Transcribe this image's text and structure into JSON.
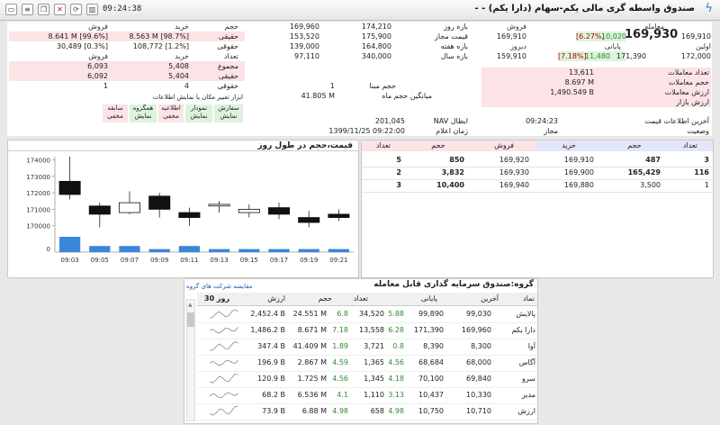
{
  "titlebar": {
    "time": "09:24:38",
    "title": "صندوق واسطه گری مالی یکم-سهام (دارا یکم) - -",
    "icons": [
      "window-icon",
      "doc-icon",
      "copy-icon",
      "chart-icon",
      "sync-icon",
      "bars-icon"
    ]
  },
  "depth_summary": {
    "headers": {
      "buy": "خرید",
      "volume": "حجم",
      "sell": "فروش"
    },
    "rows": [
      {
        "buy": "8.563 M [98.7%]",
        "label": "حقیقی",
        "sell": "8.641 M [99.6%]"
      },
      {
        "buy": "108,772 [1.2%]",
        "label": "حقوقی",
        "sell": "30,489 [0.3%]"
      }
    ],
    "count_header_buy": "خرید",
    "count_header_sell": "فروش",
    "count_rows": [
      {
        "buy": "5,408",
        "label": "حقیقی",
        "sell": "6,093"
      },
      {
        "buy": "5,404",
        "label": "حقیقی",
        "sell": "6,092"
      },
      {
        "buy": "4",
        "label": "حقوقی",
        "sell": "1"
      }
    ],
    "count_label": "تعداد",
    "total_label": "مجموع"
  },
  "range": {
    "rows": [
      {
        "label": "بازه روز",
        "a": "174,210",
        "b": "169,960"
      },
      {
        "label": "قیمت مجاز",
        "a": "175,900",
        "b": "153,520"
      },
      {
        "label": "بازه هفته",
        "a": "164,800",
        "b": "139,000"
      },
      {
        "label": "بازه سال",
        "a": "340,000",
        "b": "97,110"
      }
    ]
  },
  "price": {
    "label_trade": "معامله",
    "label_last": "فروش",
    "trade": "169,930",
    "change": "10,020",
    "change_pct": "[6.27%]",
    "close": "169,910",
    "label_close": "اولین",
    "open_label": "دیروز",
    "yesterday": "159,910",
    "last_label": "پایانی",
    "last": "171,390",
    "last_change": "11,480",
    "last_pct": "[7.18%]",
    "first": "172,000"
  },
  "stats": {
    "rows": [
      {
        "label": "تعداد معاملات",
        "value": "13,611"
      },
      {
        "label": "حجم معاملات",
        "value": "8.697 M"
      },
      {
        "label": "ارزش معاملات",
        "value": "1,490.549 B"
      },
      {
        "label": "ارزش بازار",
        "value": ""
      }
    ],
    "mid_rows": [
      {
        "label": "حجم مبنا",
        "value": "1"
      },
      {
        "label": "میانگین حجم ماه",
        "value": "41.805 M"
      }
    ],
    "nav_label": "NAV ابطال",
    "nav": "201,045",
    "nav_time_label": "زمان اعلام",
    "nav_time": "1399/11/25 09:22:00",
    "last_info_label": "آخرین اطلاعات قیمت",
    "last_info": "09:24:23",
    "status_label": "وضعیت",
    "status": "مجاز"
  },
  "buttons": {
    "caption": "ابزار تغییر مکان یا نمایش اطلاعات",
    "items": [
      {
        "top": "سفارش",
        "bottom": "نمایش"
      },
      {
        "top": "نمودار",
        "bottom": "نمایش"
      },
      {
        "top": "اطلاعیه",
        "bottom": "مخفی"
      },
      {
        "top": "همگروه",
        "bottom": "نمایش"
      },
      {
        "top": "سابقه",
        "bottom": "مخفی"
      }
    ]
  },
  "chart": {
    "title": "قیمت،حجم در طول روز"
  },
  "chart_data": {
    "type": "candlestick",
    "title": "قیمت،حجم در طول روز",
    "x": [
      "09:03",
      "09:05",
      "09:07",
      "09:09",
      "09:11",
      "09:13",
      "09:15",
      "09:17",
      "09:19",
      "09:21"
    ],
    "yticks": [
      170000,
      171000,
      172000,
      173000,
      174000
    ],
    "ylim": [
      169600,
      174200
    ],
    "candles": [
      {
        "open": 172700,
        "close": 171900,
        "high": 174200,
        "low": 171600,
        "dir": "down"
      },
      {
        "open": 171200,
        "close": 170700,
        "high": 171400,
        "low": 169900,
        "dir": "down"
      },
      {
        "open": 171400,
        "close": 170800,
        "high": 172100,
        "low": 170700,
        "dir": "up"
      },
      {
        "open": 171800,
        "close": 171000,
        "high": 172000,
        "low": 170500,
        "dir": "down"
      },
      {
        "open": 170800,
        "close": 170500,
        "high": 171100,
        "low": 170000,
        "dir": "down"
      },
      {
        "open": 171300,
        "close": 171200,
        "high": 171500,
        "low": 170800,
        "dir": "up"
      },
      {
        "open": 171000,
        "close": 170800,
        "high": 171300,
        "low": 170500,
        "dir": "up"
      },
      {
        "open": 171100,
        "close": 170700,
        "high": 171400,
        "low": 170400,
        "dir": "down"
      },
      {
        "open": 170500,
        "close": 170200,
        "high": 170900,
        "low": 169900,
        "dir": "down"
      },
      {
        "open": 170700,
        "close": 170500,
        "high": 171000,
        "low": 170300,
        "dir": "down"
      }
    ],
    "volumes": [
      5,
      2,
      2,
      1,
      2,
      1,
      1,
      1,
      1,
      1
    ],
    "volume_axis_label": "0"
  },
  "orderbook": {
    "headers": {
      "count_buy": "تعداد",
      "vol_buy": "حجم",
      "price_buy": "خرید",
      "price_sell": "فروش",
      "vol_sell": "حجم",
      "count_sell": "تعداد"
    },
    "rows": [
      {
        "count_buy": "3",
        "vol_buy": "487",
        "price_buy": "169,910",
        "price_sell": "169,920",
        "vol_sell": "850",
        "count_sell": "5"
      },
      {
        "count_buy": "116",
        "vol_buy": "165,429",
        "price_buy": "169,900",
        "price_sell": "169,930",
        "vol_sell": "3,832",
        "count_sell": "2"
      },
      {
        "count_buy": "1",
        "vol_buy": "3,500",
        "price_buy": "169,880",
        "price_sell": "169,940",
        "vol_sell": "10,400",
        "count_sell": "3"
      }
    ]
  },
  "group": {
    "title": "گروه:صندوق سرمایه گذاری قابل معامله",
    "subtitle": "مقایسه شرکت های گروه",
    "headers": {
      "symbol": "نماد",
      "last": "آخرین",
      "close": "پایانی",
      "count": "تعداد",
      "volume": "حجم",
      "value": "ارزش",
      "chart": "30 روز"
    },
    "rows": [
      {
        "symbol": "پالایش",
        "last": "99,030",
        "close": "99,890",
        "pct": "5.88",
        "count": "34,520",
        "pct2": "6.8",
        "volume": "24.551 M",
        "value": "2,452.4 B"
      },
      {
        "symbol": "دارا یکم",
        "last": "169,960",
        "close": "171,390",
        "pct": "6.28",
        "count": "13,558",
        "pct2": "7.18",
        "volume": "8.671 M",
        "value": "1,486.2 B"
      },
      {
        "symbol": "آوا",
        "last": "8,300",
        "close": "8,390",
        "pct": "0.8",
        "count": "3,721",
        "pct2": "1.89",
        "volume": "41.409 M",
        "value": "347.4 B"
      },
      {
        "symbol": "آگاس",
        "last": "68,000",
        "close": "68,684",
        "pct": "4.56",
        "count": "1,365",
        "pct2": "4.59",
        "volume": "2.867 M",
        "value": "196.9 B"
      },
      {
        "symbol": "سرو",
        "last": "69,840",
        "close": "70,100",
        "pct": "4.18",
        "count": "1,345",
        "pct2": "4.56",
        "volume": "1.725 M",
        "value": "120.9 B"
      },
      {
        "symbol": "مدیر",
        "last": "10,330",
        "close": "10,437",
        "pct": "3.13",
        "count": "1,110",
        "pct2": "4.1",
        "volume": "6.536 M",
        "value": "68.2 B"
      },
      {
        "symbol": "ارزش",
        "last": "10,710",
        "close": "10,750",
        "pct": "4.98",
        "count": "658",
        "pct2": "4.98",
        "volume": "6.88 M",
        "value": "73.9 B"
      }
    ]
  }
}
